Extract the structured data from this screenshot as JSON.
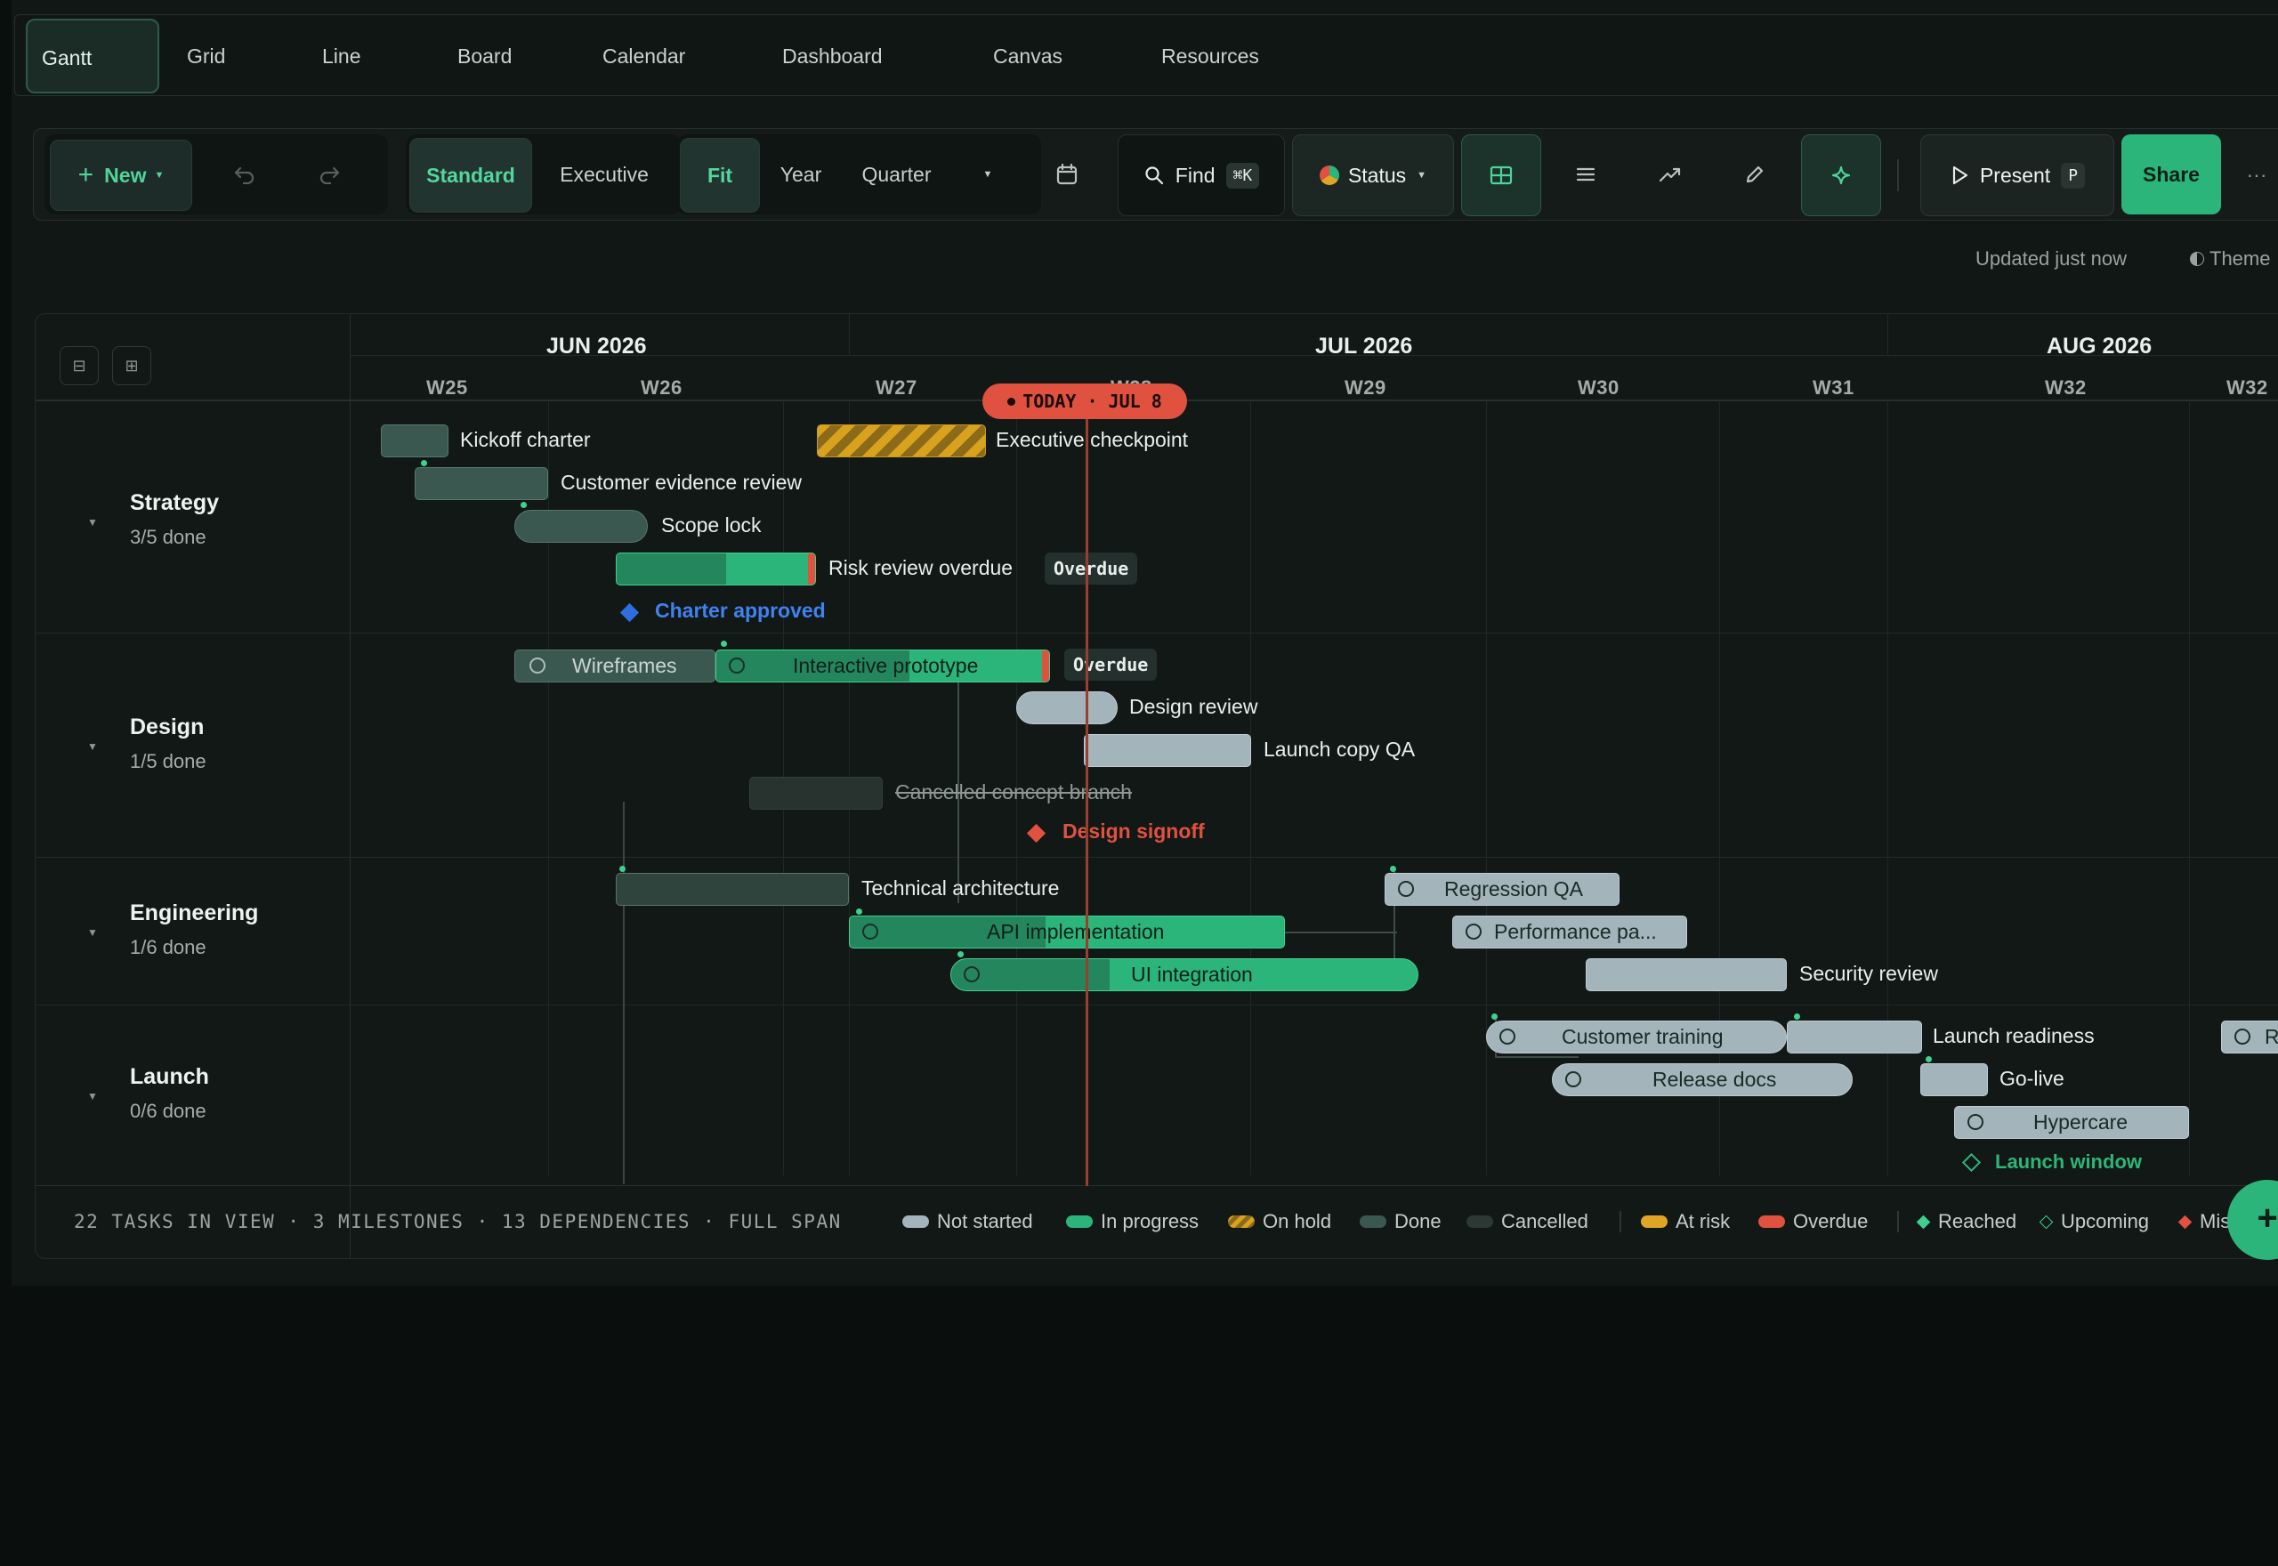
{
  "tabs": [
    "Gantt",
    "Grid",
    "Line",
    "Board",
    "Calendar",
    "Dashboard",
    "Canvas",
    "Resources"
  ],
  "toolbar": {
    "new_label": "New",
    "view_standard": "Standard",
    "view_executive": "Executive",
    "zoom_fit": "Fit",
    "zoom_year": "Year",
    "zoom_quarter": "Quarter",
    "find_label": "Find",
    "find_shortcut": "⌘K",
    "status_label": "Status",
    "present_label": "Present",
    "present_shortcut": "P",
    "share_label": "Share",
    "more_label": "···"
  },
  "status_bar": {
    "updated": "Updated just now",
    "theme": "Theme"
  },
  "timeline": {
    "months": [
      "JUN 2026",
      "JUL 2026",
      "AUG 2026"
    ],
    "weeks": [
      "W25",
      "W26",
      "W27",
      "W28",
      "W29",
      "W30",
      "W31",
      "W32",
      "W32"
    ],
    "today_label": "TODAY · JUL 8"
  },
  "groups": [
    {
      "name": "Strategy",
      "done": "3/5 done"
    },
    {
      "name": "Design",
      "done": "1/5 done"
    },
    {
      "name": "Engineering",
      "done": "1/6 done"
    },
    {
      "name": "Launch",
      "done": "0/6 done"
    }
  ],
  "tasks": {
    "kickoff": "Kickoff charter",
    "evidence": "Customer evidence review",
    "scope": "Scope lock",
    "risk": "Risk review overdue",
    "checkpoint": "Executive checkpoint",
    "charter": "Charter approved",
    "wireframes": "Wireframes",
    "prototype": "Interactive prototype",
    "design_review": "Design review",
    "copy_qa": "Launch copy QA",
    "cancelled": "Cancelled concept branch",
    "signoff": "Design signoff",
    "arch": "Technical architecture",
    "api": "API implementation",
    "ui": "UI integration",
    "regression": "Regression QA",
    "perf": "Performance pa...",
    "security": "Security review",
    "training": "Customer training",
    "readiness": "Launch readiness",
    "release_docs": "Release docs",
    "golive": "Go-live",
    "hypercare": "Hypercare",
    "window": "Launch window",
    "r": "R"
  },
  "progress": {
    "risk": 0.55,
    "prototype": 0.58,
    "api": 0.45,
    "ui": 0.34
  },
  "overdue_tag": "Overdue",
  "footer": {
    "summary": "22 TASKS IN VIEW · 3 MILESTONES · 13 DEPENDENCIES · FULL SPAN",
    "legend": [
      "Not started",
      "In progress",
      "On hold",
      "Done",
      "Cancelled",
      "At risk",
      "Overdue",
      "Reached",
      "Upcoming",
      "Mis"
    ]
  },
  "colors": {
    "accent": "#2cb57a",
    "overdue": "#e0513f",
    "at_risk": "#e0a524",
    "milestone_reached": "#3fd08e",
    "milestone_charter": "#2f6ee0"
  }
}
